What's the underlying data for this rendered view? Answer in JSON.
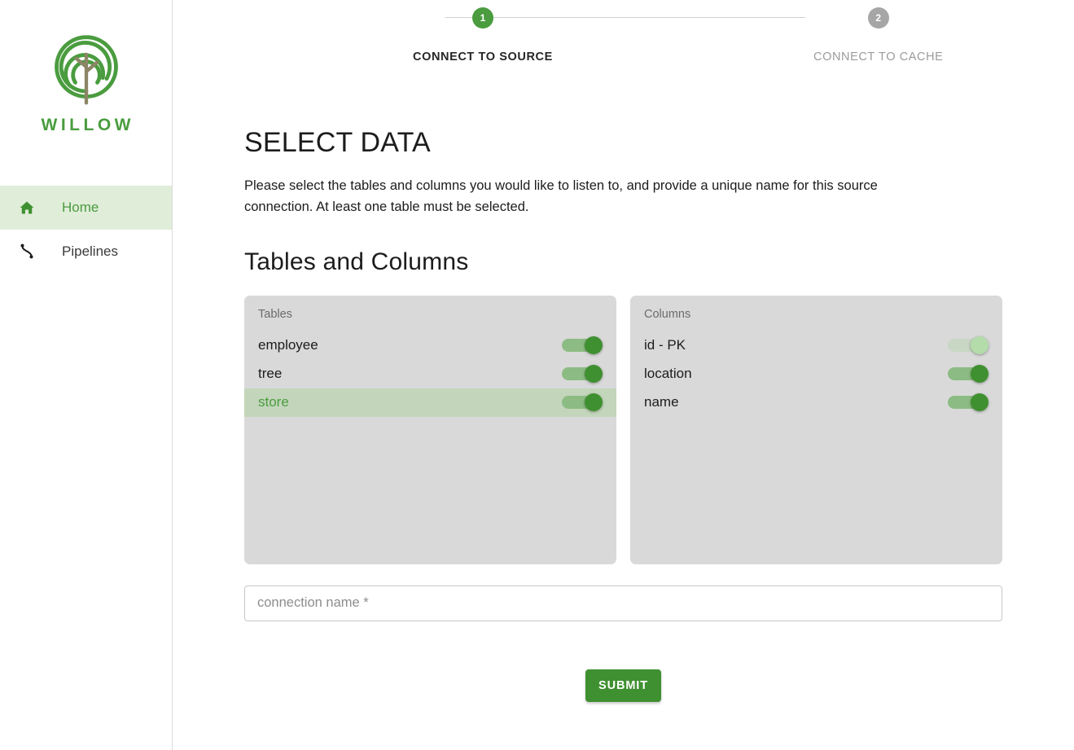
{
  "brand": {
    "name": "WILLOW",
    "logo_icon": "willow-tree-logo",
    "logo_ring_color": "#4a9c3f",
    "logo_trunk_color": "#8c8566"
  },
  "sidebar": {
    "items": [
      {
        "label": "Home",
        "icon": "home-icon",
        "active": true
      },
      {
        "label": "Pipelines",
        "icon": "pipelines-icon",
        "active": false
      }
    ]
  },
  "stepper": {
    "steps": [
      {
        "number": "1",
        "label": "CONNECT TO SOURCE",
        "state": "active"
      },
      {
        "number": "2",
        "label": "CONNECT TO CACHE",
        "state": "inactive"
      }
    ],
    "active_color": "#4a9c3f",
    "inactive_color": "#a6a6a6"
  },
  "main": {
    "page_title": "SELECT DATA",
    "description": "Please select the tables and columns you would like to listen to, and provide a unique name for this source connection. At least one table must be selected.",
    "section_title": "Tables and Columns"
  },
  "tables_panel": {
    "title": "Tables",
    "rows": [
      {
        "label": "employee",
        "toggle_on": true,
        "toggle_disabled": false,
        "selected": false
      },
      {
        "label": "tree",
        "toggle_on": true,
        "toggle_disabled": false,
        "selected": false
      },
      {
        "label": "store",
        "toggle_on": true,
        "toggle_disabled": false,
        "selected": true
      }
    ]
  },
  "columns_panel": {
    "title": "Columns",
    "rows": [
      {
        "label": "id - PK",
        "toggle_on": true,
        "toggle_disabled": true,
        "selected": false
      },
      {
        "label": "location",
        "toggle_on": true,
        "toggle_disabled": false,
        "selected": false
      },
      {
        "label": "name",
        "toggle_on": true,
        "toggle_disabled": false,
        "selected": false
      }
    ]
  },
  "form": {
    "connection_name_placeholder": "connection name *",
    "connection_name_value": "",
    "submit_label": "SUBMIT",
    "submit_color": "#3f9030"
  }
}
